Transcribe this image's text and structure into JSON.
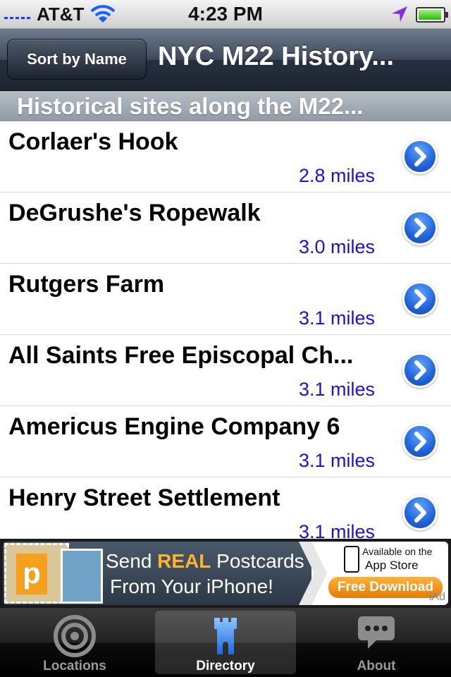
{
  "status_bar": {
    "carrier": "AT&T",
    "time": "4:23 PM"
  },
  "nav": {
    "sort_button": "Sort by Name",
    "title": "NYC M22 History..."
  },
  "section": {
    "title": "Historical sites along the M22..."
  },
  "list": {
    "items": [
      {
        "name": "Corlaer's Hook",
        "distance": "2.8 miles"
      },
      {
        "name": "DeGrushe's Ropewalk",
        "distance": "3.0 miles"
      },
      {
        "name": "Rutgers Farm",
        "distance": "3.1 miles"
      },
      {
        "name": "All Saints Free Episcopal Ch...",
        "distance": "3.1 miles"
      },
      {
        "name": "Americus Engine Company 6",
        "distance": "3.1 miles"
      },
      {
        "name": "Henry Street Settlement",
        "distance": "3.1 miles"
      }
    ]
  },
  "ad": {
    "logo_letter": "p",
    "line1_prefix": "Send ",
    "line1_highlight": "REAL",
    "line1_suffix": " Postcards",
    "line2": "From Your iPhone!",
    "available_line1": "Available on the",
    "available_line2": "App Store",
    "cta": "Free Download",
    "badge": "iAd"
  },
  "tabbar": {
    "tabs": [
      {
        "label": "Locations",
        "icon": "target-icon",
        "selected": false
      },
      {
        "label": "Directory",
        "icon": "tower-icon",
        "selected": true
      },
      {
        "label": "About",
        "icon": "speech-bubble-icon",
        "selected": false
      }
    ]
  },
  "colors": {
    "distance_text": "#1a12d8",
    "accent_blue": "#1f63d8",
    "ad_cta": "#e27d05"
  }
}
